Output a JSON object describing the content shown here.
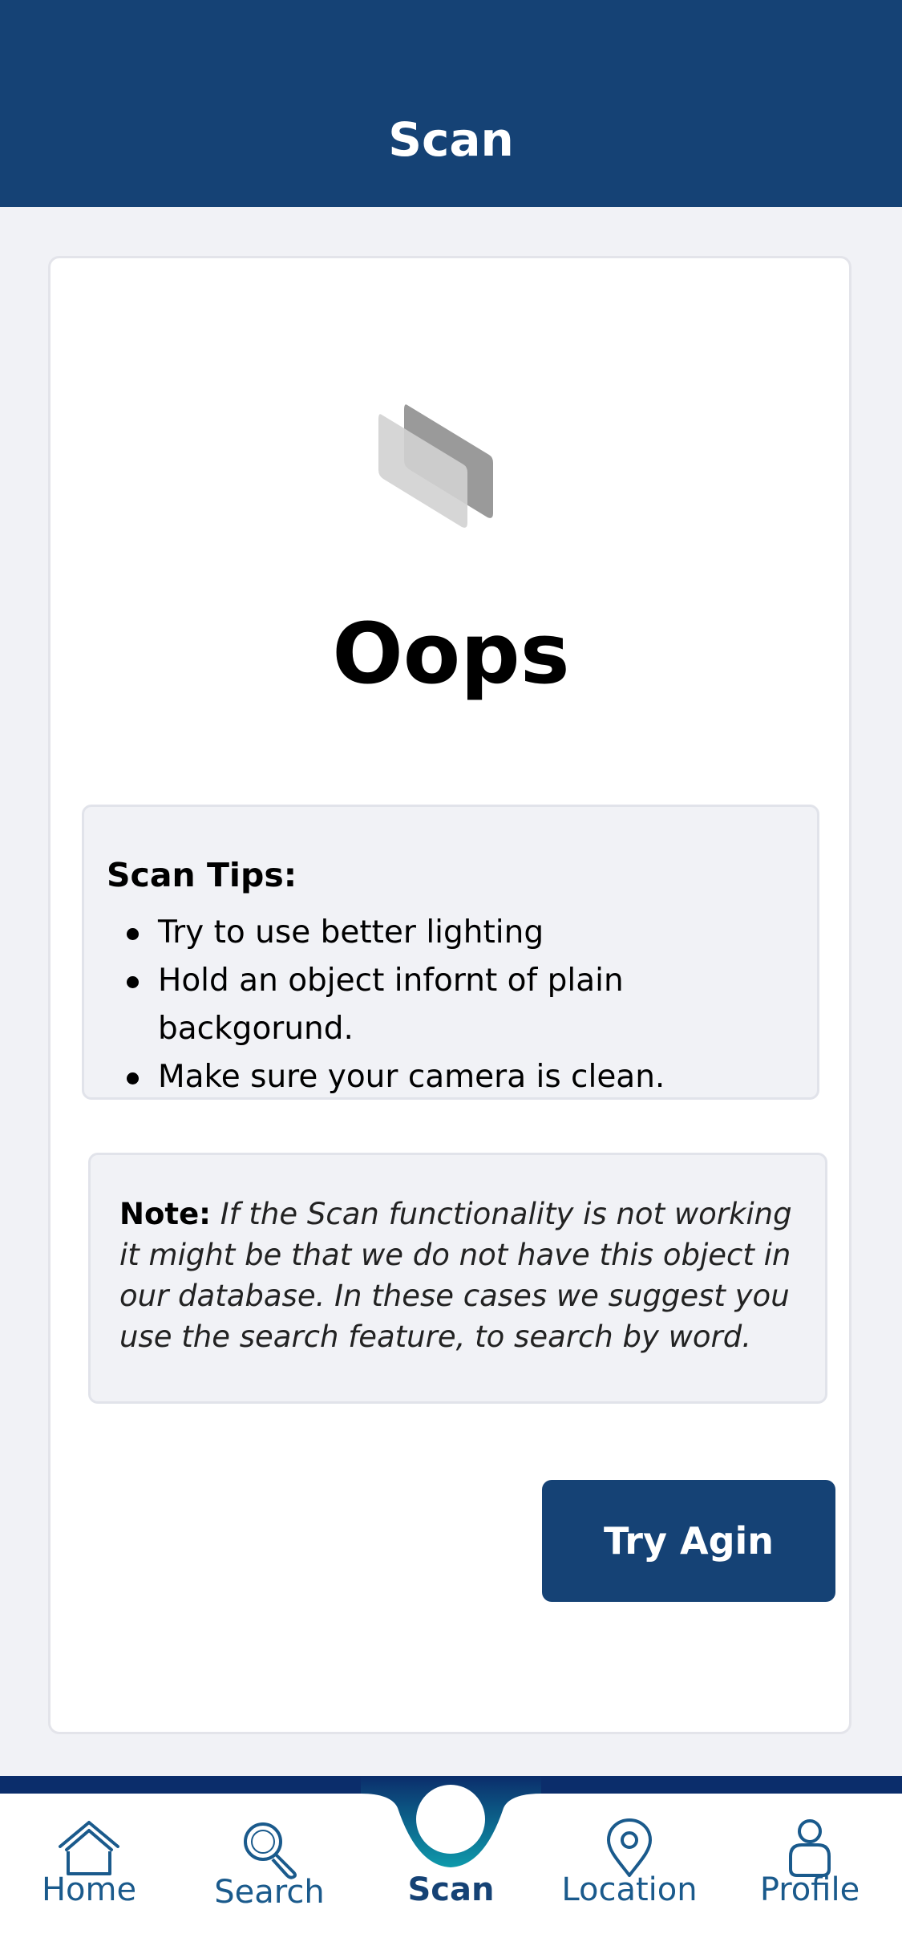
{
  "header": {
    "title": "Scan"
  },
  "result": {
    "heading": "Oops",
    "illustration_icon": "stacked-cards-icon"
  },
  "tips": {
    "title": "Scan Tips:",
    "items": [
      "Try to use better lighting",
      " Hold an object infornt of plain backgorund.",
      "Make sure your camera is clean."
    ]
  },
  "note": {
    "label": "Note:",
    "text": " If the Scan functionality is not working it might be that we do not have this object in our database. In these cases we suggest you use the search feature, to search by word."
  },
  "actions": {
    "try_again_label": "Try Agin"
  },
  "tabbar": {
    "items": [
      {
        "label": "Home",
        "icon": "home-icon"
      },
      {
        "label": "Search",
        "icon": "search-icon"
      },
      {
        "label": "Scan",
        "icon": "scan-ring-icon"
      },
      {
        "label": "Location",
        "icon": "location-pin-icon"
      },
      {
        "label": "Profile",
        "icon": "profile-icon"
      }
    ],
    "active": "Scan"
  },
  "colors": {
    "primary": "#154275",
    "accent": "#0e9aab",
    "background": "#f1f2f6",
    "tab_icon": "#1a5a8c"
  }
}
